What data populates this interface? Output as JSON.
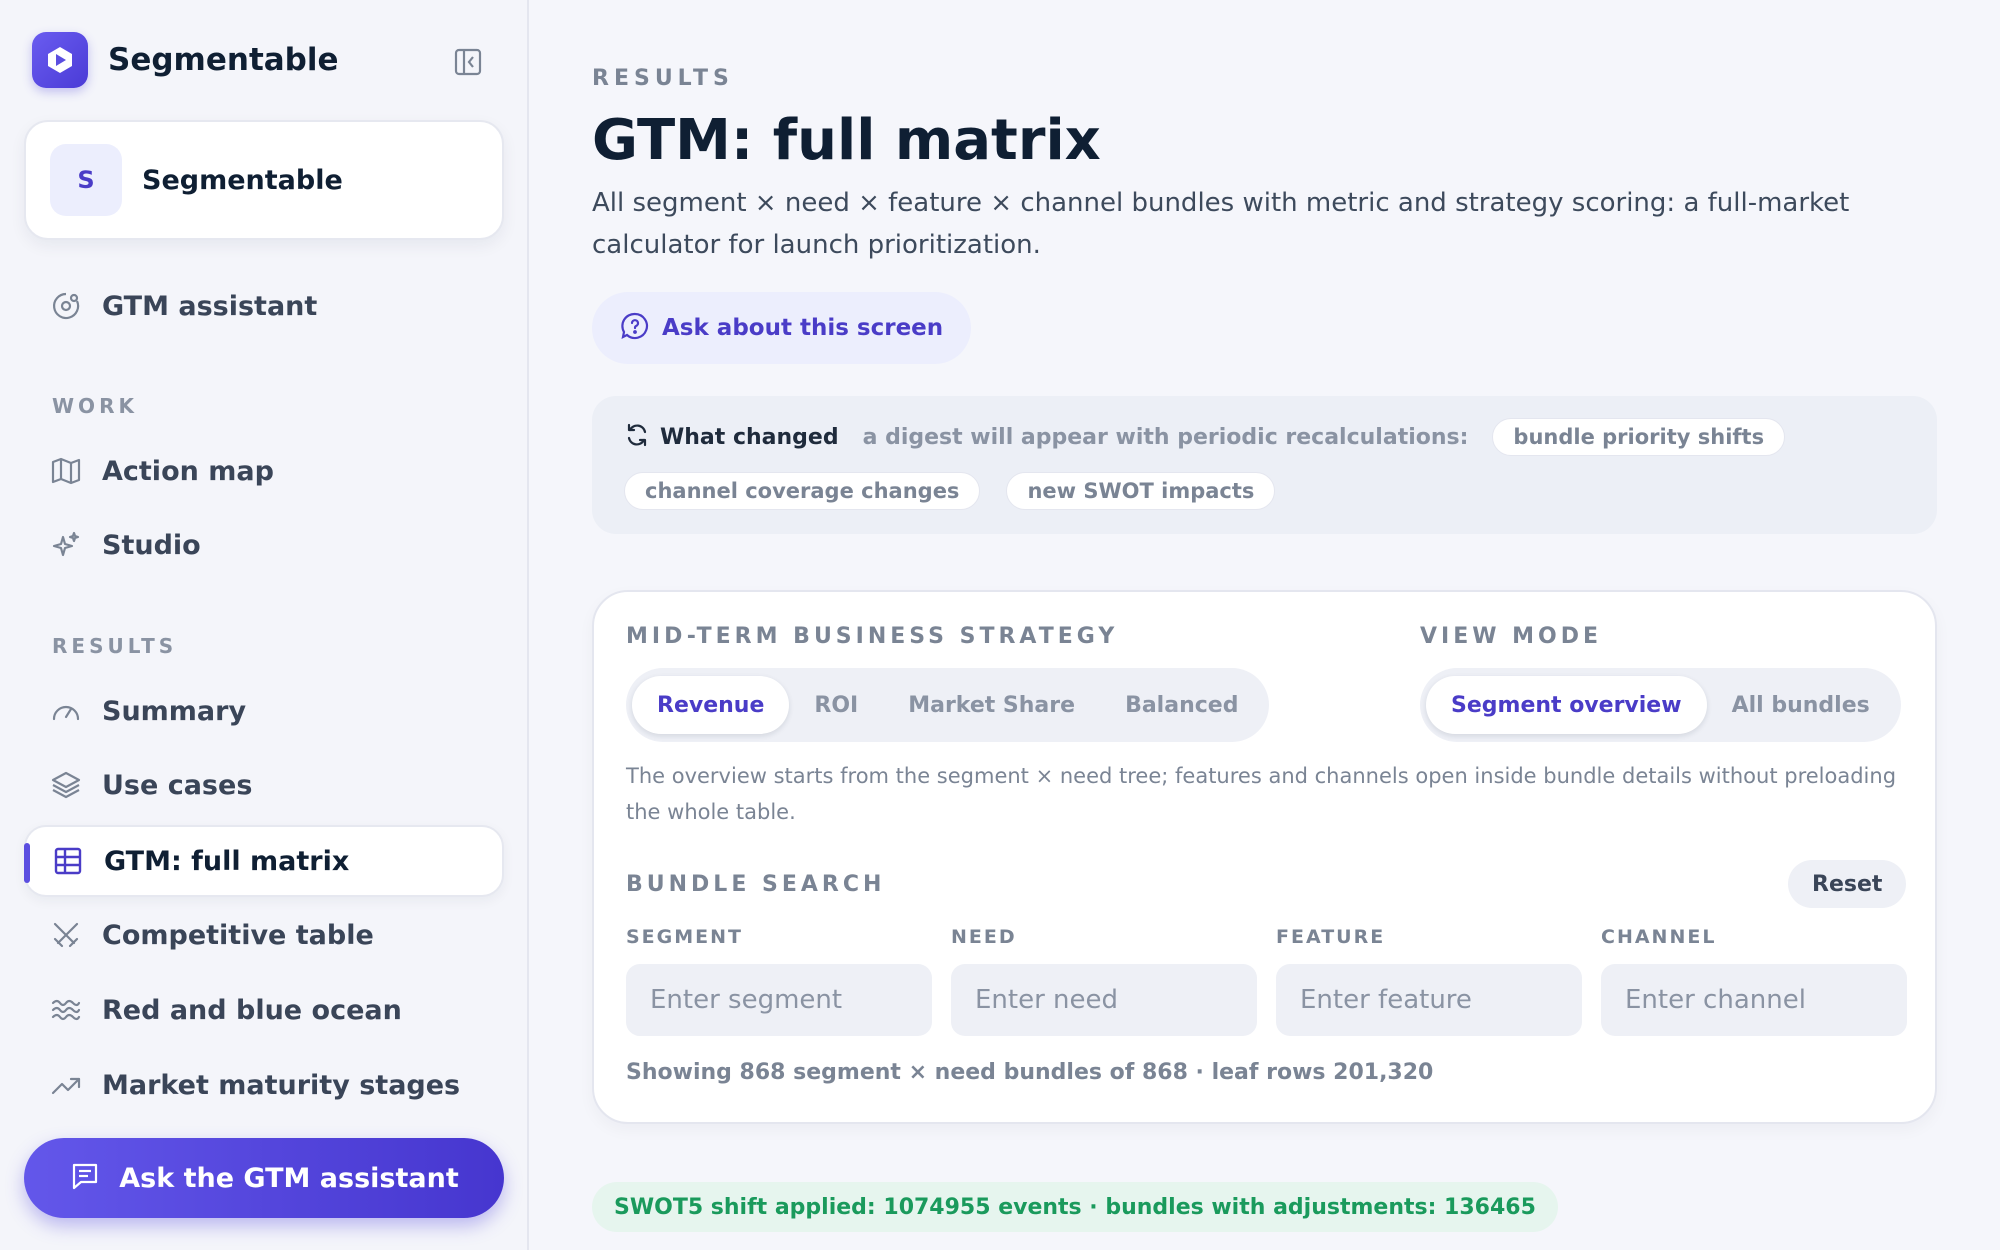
{
  "app": {
    "name": "Segmentable",
    "accent": "#5b4ee0"
  },
  "workspace": {
    "initial": "S",
    "name": "Segmentable"
  },
  "sidebar": {
    "assistant_item": {
      "label": "GTM assistant",
      "icon": "assistant-icon"
    },
    "sections": [
      {
        "label": "WORK",
        "items": [
          {
            "label": "Action map",
            "icon": "map-icon"
          },
          {
            "label": "Studio",
            "icon": "sparkles-icon"
          }
        ]
      },
      {
        "label": "RESULTS",
        "items": [
          {
            "label": "Summary",
            "icon": "gauge-icon"
          },
          {
            "label": "Use cases",
            "icon": "layers-icon"
          },
          {
            "label": "GTM: full matrix",
            "icon": "grid-icon",
            "active": true
          },
          {
            "label": "Competitive table",
            "icon": "swords-icon"
          },
          {
            "label": "Red and blue ocean",
            "icon": "waves-icon"
          },
          {
            "label": "Market maturity stages",
            "icon": "trend-icon"
          }
        ]
      }
    ],
    "ask_button": "Ask the GTM assistant"
  },
  "main": {
    "eyebrow": "RESULTS",
    "title": "GTM: full matrix",
    "description": "All segment × need × feature × channel bundles with metric and strategy scoring: a full-market calculator for launch prioritization.",
    "ask_screen": "Ask about this screen",
    "what_changed": {
      "title": "What changed",
      "subtitle": "a digest will appear with periodic recalculations:",
      "chips": [
        "bundle priority shifts",
        "channel coverage changes",
        "new SWOT impacts"
      ]
    },
    "panel": {
      "strategy_label": "MID-TERM BUSINESS STRATEGY",
      "strategy_options": [
        "Revenue",
        "ROI",
        "Market Share",
        "Balanced"
      ],
      "strategy_selected": "Revenue",
      "view_label": "VIEW MODE",
      "view_options": [
        "Segment overview",
        "All bundles"
      ],
      "view_selected": "Segment overview",
      "note": "The overview starts from the segment × need tree; features and channels open inside bundle details without preloading the whole table.",
      "search_label": "BUNDLE SEARCH",
      "reset": "Reset",
      "fields": [
        {
          "label": "SEGMENT",
          "placeholder": "Enter segment",
          "value": ""
        },
        {
          "label": "NEED",
          "placeholder": "Enter need",
          "value": ""
        },
        {
          "label": "FEATURE",
          "placeholder": "Enter feature",
          "value": ""
        },
        {
          "label": "CHANNEL",
          "placeholder": "Enter channel",
          "value": ""
        }
      ],
      "showing": "Showing 868 segment × need bundles of 868 · leaf rows 201,320"
    },
    "swot_badge": "SWOT5 shift applied: 1074955 events · bundles with adjustments: 136465"
  }
}
